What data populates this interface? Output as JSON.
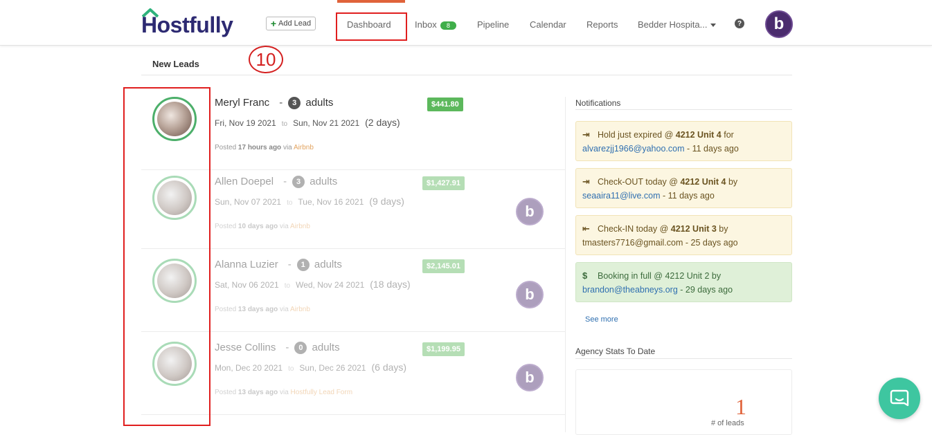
{
  "brand": {
    "logo_text": "Hostfully",
    "roof_color": "#2fb27c",
    "text_color": "#2d2a72"
  },
  "header": {
    "add_lead_label": "Add Lead",
    "nav": {
      "dashboard": "Dashboard",
      "inbox": "Inbox",
      "inbox_count": "8",
      "pipeline": "Pipeline",
      "calendar": "Calendar",
      "reports": "Reports",
      "account": "Bedder Hospita..."
    },
    "help_icon": "question-circle-icon",
    "avatar_letter": "b",
    "active_color": "#e0633a"
  },
  "annotation": {
    "step": "10"
  },
  "leads_section": {
    "title": "New Leads"
  },
  "leads": [
    {
      "name": "Meryl Franc",
      "adults": "3",
      "adults_label": "adults",
      "from": "Fri, Nov 19 2021",
      "to_label": "to",
      "to": "Sun, Nov 21 2021",
      "duration": "(2 days)",
      "posted_prefix": "Posted",
      "posted_ago": "17 hours ago",
      "via": "via",
      "source": "Airbnb",
      "price": "$441.80",
      "avatar_letter": ""
    },
    {
      "name": "Allen Doepel",
      "adults": "3",
      "adults_label": "adults",
      "from": "Sun, Nov 07 2021",
      "to_label": "to",
      "to": "Tue, Nov 16 2021",
      "duration": "(9 days)",
      "posted_prefix": "Posted",
      "posted_ago": "10 days ago",
      "via": "via",
      "source": "Airbnb",
      "price": "$1,427.91",
      "avatar_letter": "b"
    },
    {
      "name": "Alanna Luzier",
      "adults": "1",
      "adults_label": "adults",
      "from": "Sat, Nov 06 2021",
      "to_label": "to",
      "to": "Wed, Nov 24 2021",
      "duration": "(18 days)",
      "posted_prefix": "Posted",
      "posted_ago": "13 days ago",
      "via": "via",
      "source": "Airbnb",
      "price": "$2,145.01",
      "avatar_letter": "b"
    },
    {
      "name": "Jesse Collins",
      "adults": "0",
      "adults_label": "adults",
      "from": "Mon, Dec 20 2021",
      "to_label": "to",
      "to": "Sun, Dec 26 2021",
      "duration": "(6 days)",
      "posted_prefix": "Posted",
      "posted_ago": "13 days ago",
      "via": "via",
      "source": "Hostfully Lead Form",
      "price": "$1,199.95",
      "avatar_letter": "b"
    }
  ],
  "notifications": {
    "title": "Notifications",
    "items": [
      {
        "icon": "sign-out-icon",
        "pre": "Hold just expired @ ",
        "unit": "4212 Unit 4",
        "post": " for",
        "email": "alvarezjj1966@yahoo.com",
        "ago": " -  11 days ago"
      },
      {
        "icon": "sign-out-icon",
        "pre": "Check-OUT today @ ",
        "unit": "4212 Unit 4",
        "post": " by",
        "email": "seaaira11@live.com",
        "ago": " -  11 days ago"
      },
      {
        "icon": "sign-in-icon",
        "pre": "Check-IN today @ ",
        "unit": "4212 Unit 3",
        "post": " by",
        "email": "tmasters7716@gmail.com",
        "ago": " -  25 days ago"
      },
      {
        "icon": "dollar-icon",
        "pre": "Booking in full @ 4212 Unit 2 by",
        "unit": "",
        "post": "",
        "email": "brandon@theabneys.org",
        "ago": " -  29 days ago"
      }
    ],
    "see_more": "See more"
  },
  "stats": {
    "title": "Agency Stats To Date",
    "value": "1",
    "label": "# of leads"
  }
}
